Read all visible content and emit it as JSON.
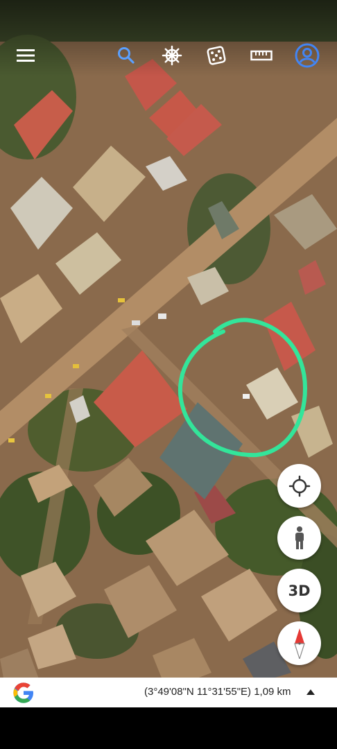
{
  "toolbar": {
    "icons": [
      "menu-icon",
      "search-icon",
      "voyager-helm-icon",
      "feeling-lucky-dice-icon",
      "measure-ruler-icon",
      "account-icon"
    ],
    "account_color": "#4285f4"
  },
  "map": {
    "annotation_color": "#33e59a",
    "imagery": "satellite"
  },
  "controls": {
    "locate_icon": "crosshair-icon",
    "street_view_icon": "pegman-icon",
    "view_3d_label": "3D",
    "compass_icon": "compass-icon"
  },
  "status_bar": {
    "coordinates": "(3°49'08\"N 11°31'55\"E) 1,09 km"
  },
  "colors": {
    "road": "#b08a63",
    "roof_red": "#c95a49",
    "vegetation": "#4b5a2c",
    "bare_ground": "#9c7757"
  }
}
